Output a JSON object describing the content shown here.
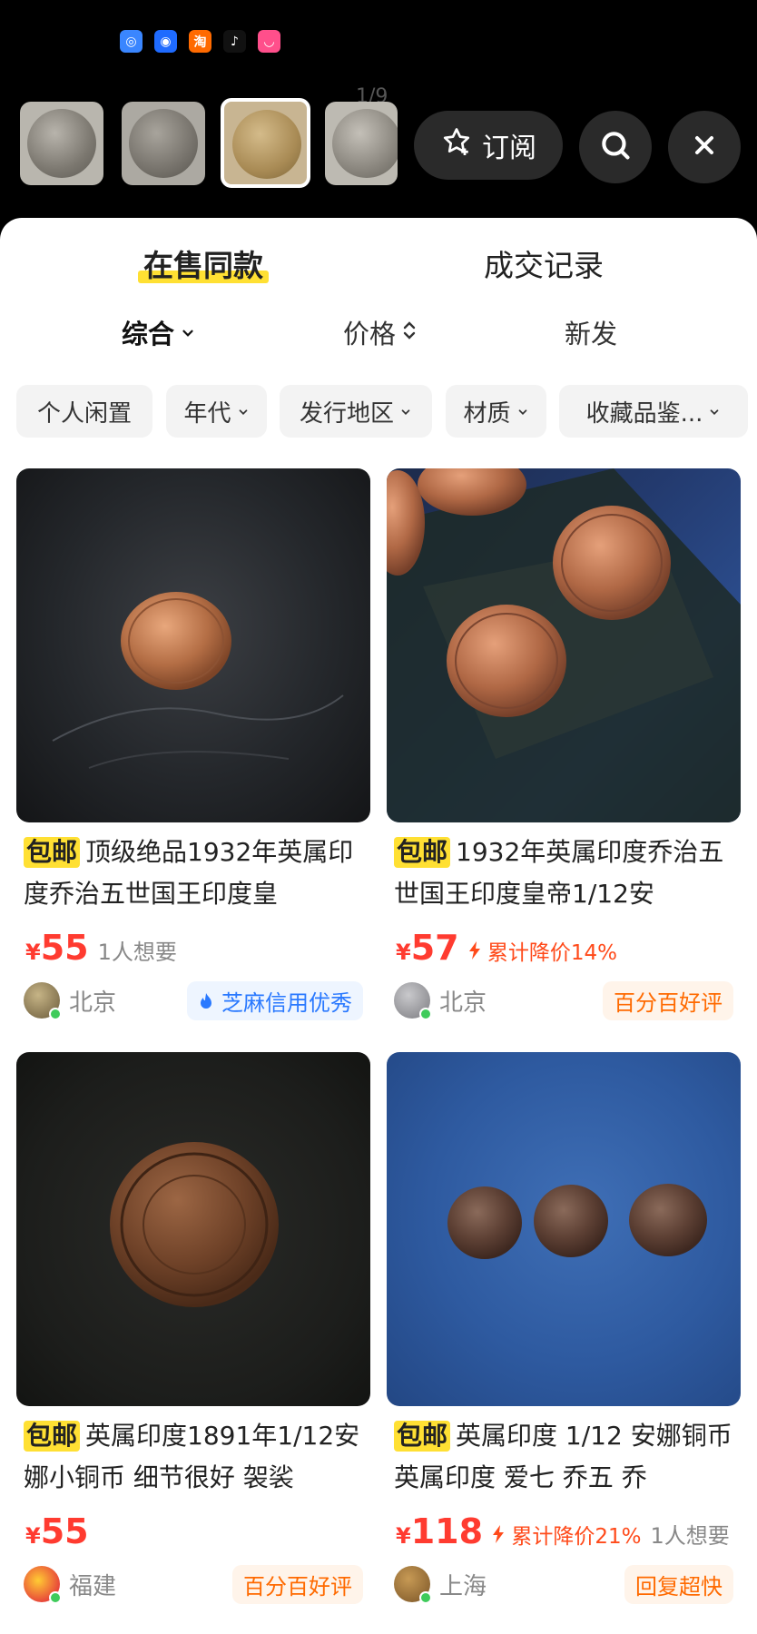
{
  "colors": {
    "accent_yellow": "#ffe033",
    "price_red": "#ff3b30",
    "drop_orange": "#ff4a1a",
    "credit_blue": "#2a79ff",
    "tag_orange": "#ff6a00"
  },
  "status_icons": [
    {
      "name": "chat-app-icon",
      "color": "#3a86ff",
      "glyph": "◎"
    },
    {
      "name": "bird-app-icon",
      "color": "#1f6bff",
      "glyph": "◉"
    },
    {
      "name": "taobao-app-icon",
      "color": "#ff6a00",
      "glyph": "淘"
    },
    {
      "name": "tiktok-app-icon",
      "color": "#111111",
      "glyph": "♪"
    },
    {
      "name": "pink-app-icon",
      "color": "#ff4f8b",
      "glyph": "◡"
    }
  ],
  "header": {
    "page_indicator": "1/9",
    "subscribe_label": "订阅"
  },
  "main_tabs": [
    "在售同款",
    "成交记录"
  ],
  "sort": {
    "overall": "综合",
    "price": "价格",
    "new": "新发"
  },
  "filters": [
    "个人闲置",
    "年代",
    "发行地区",
    "材质",
    "收藏品鉴..."
  ],
  "cards": [
    {
      "badge": "包邮",
      "title": "顶级绝品1932年英属印度乔治五世国王印度皇",
      "price": "55",
      "want": "1人想要",
      "drop": "",
      "location": "北京",
      "tag": "芝麻信用优秀"
    },
    {
      "badge": "包邮",
      "title": "1932年英属印度乔治五世国王印度皇帝1/12安",
      "price": "57",
      "want": "",
      "drop": "累计降价14%",
      "location": "北京",
      "tag": "百分百好评"
    },
    {
      "badge": "包邮",
      "title": "英属印度1891年1/12安娜小铜币 细节很好 袈裟",
      "price": "55",
      "want": "",
      "drop": "",
      "location": "福建",
      "tag": "百分百好评"
    },
    {
      "badge": "包邮",
      "title": "英属印度 1/12 安娜铜币 英属印度 爱七 乔五 乔",
      "price": "118",
      "want": "1人想要",
      "drop": "累计降价21%",
      "location": "上海",
      "tag": "回复超快"
    }
  ]
}
